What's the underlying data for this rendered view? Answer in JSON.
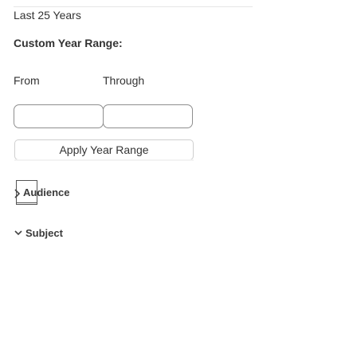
{
  "year_filter": {
    "preset_link": "Last 25 Years",
    "custom_heading": "Custom Year Range:",
    "from_label": "From",
    "through_label": "Through",
    "from_value": "",
    "through_value": "",
    "apply_label": "Apply Year Range"
  },
  "facets": {
    "audience": {
      "label": "Audience",
      "icon": "chevron-right-icon",
      "focused": true
    },
    "subject": {
      "label": "Subject",
      "icon": "chevron-down-icon"
    }
  }
}
